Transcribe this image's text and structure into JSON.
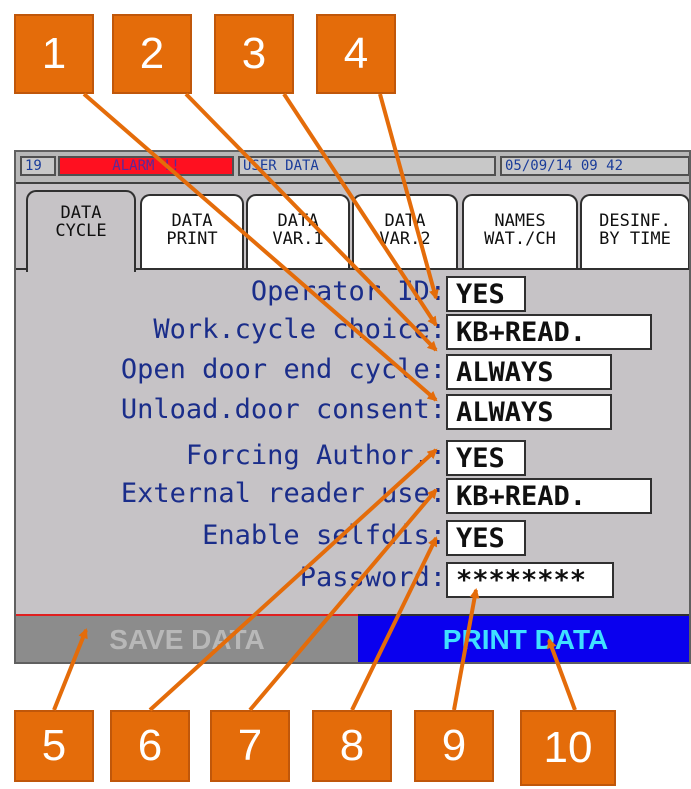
{
  "callouts": [
    "1",
    "2",
    "3",
    "4",
    "5",
    "6",
    "7",
    "8",
    "9",
    "10"
  ],
  "status_bar": {
    "counter": "19",
    "alarm": "ALARM !!",
    "title": "USER DATA",
    "datetime": "05/09/14  09 42"
  },
  "tabs": [
    {
      "line1": "DATA",
      "line2": "CYCLE",
      "active": true
    },
    {
      "line1": "DATA",
      "line2": "PRINT",
      "active": false
    },
    {
      "line1": "DATA",
      "line2": "VAR.1",
      "active": false
    },
    {
      "line1": "DATA",
      "line2": "VAR.2",
      "active": false
    },
    {
      "line1": "NAMES",
      "line2": "WAT./CH",
      "active": false
    },
    {
      "line1": "DESINF.",
      "line2": "BY TIME",
      "active": false
    }
  ],
  "settings": [
    {
      "label": "Operator ID:",
      "value": "YES"
    },
    {
      "label": "Work.cycle choice:",
      "value": "KB+READ."
    },
    {
      "label": "Open door end cycle:",
      "value": "ALWAYS"
    },
    {
      "label": "Unload.door consent:",
      "value": "ALWAYS"
    },
    {
      "label": "Forcing Author.:",
      "value": "YES"
    },
    {
      "label": "External reader use:",
      "value": "KB+READ."
    },
    {
      "label": "Enable selfdis:",
      "value": "YES"
    },
    {
      "label": "Password:",
      "value": "********"
    }
  ],
  "buttons": {
    "save": "SAVE DATA",
    "print": "PRINT DATA"
  },
  "colors": {
    "badge": "#e46c0a",
    "screen_bg": "#c6c3c6",
    "label_text": "#1a2d8a",
    "print_button": "#0a00ee",
    "alarm": "#ff1020"
  }
}
